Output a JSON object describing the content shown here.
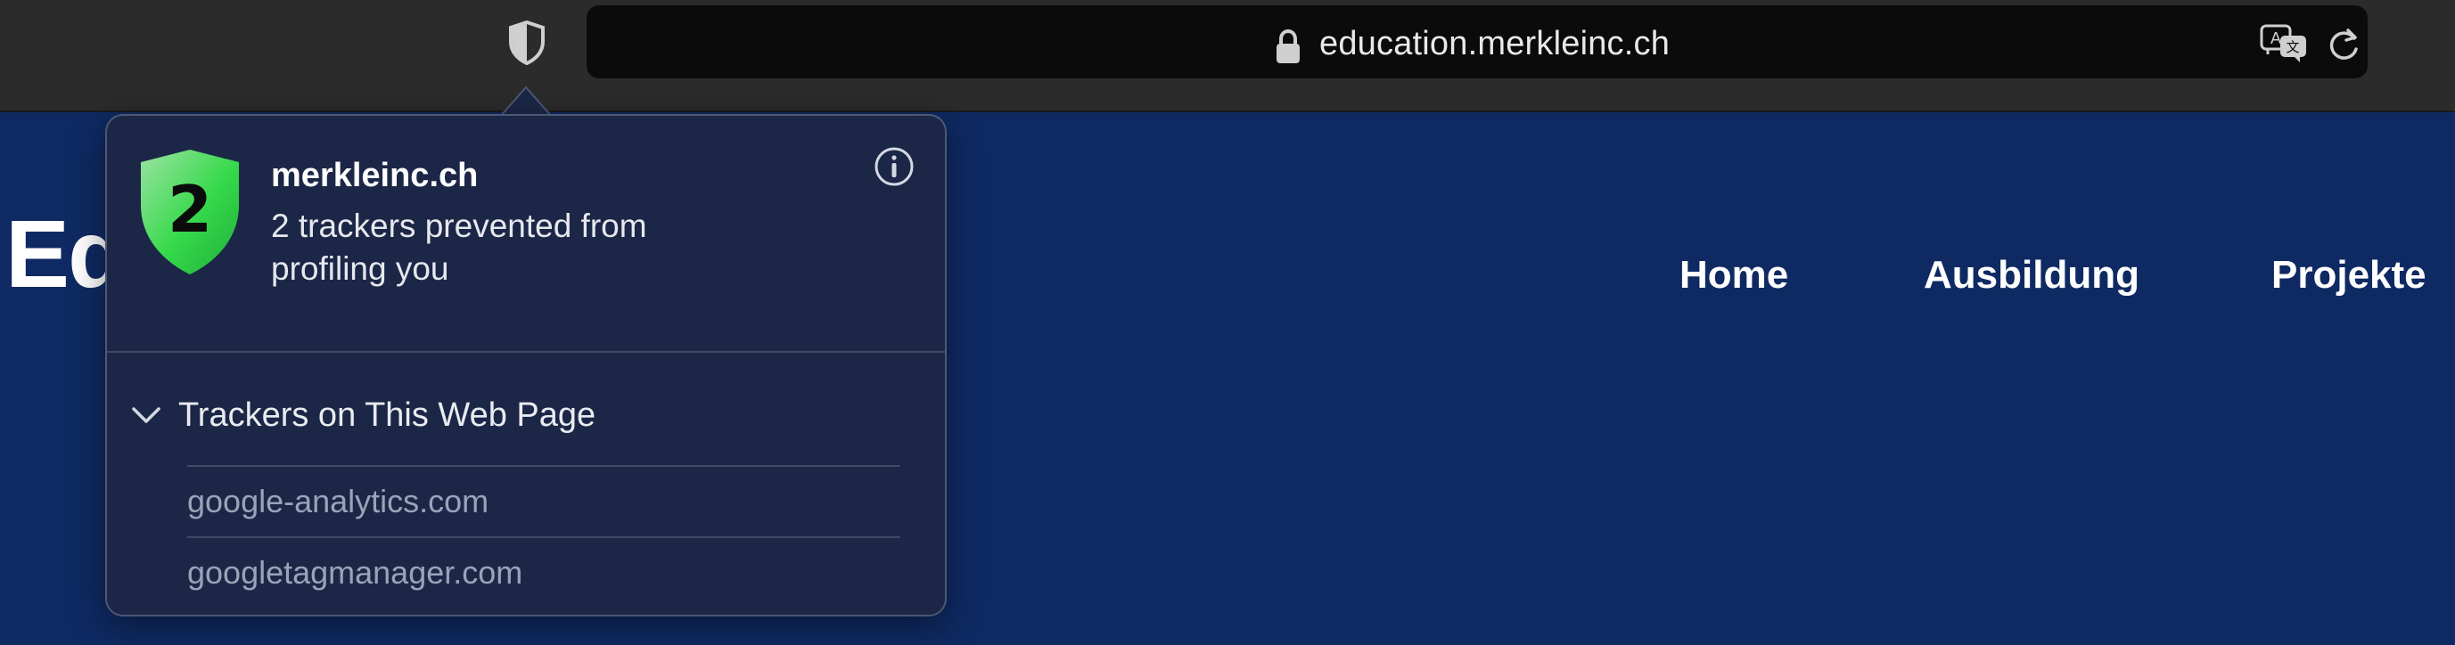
{
  "browser": {
    "url": "education.merkleinc.ch"
  },
  "page": {
    "logo_text": "Ed",
    "nav": [
      "Home",
      "Ausbildung",
      "Projekte"
    ]
  },
  "popover": {
    "badge_count": "2",
    "site": "merkleinc.ch",
    "summary": "2 trackers prevented from profiling you",
    "section_title": "Trackers on This Web Page",
    "trackers": [
      "google-analytics.com",
      "googletagmanager.com"
    ]
  },
  "colors": {
    "page_background": "#0f2a63",
    "popover_background": "#1c2747",
    "badge_green": "#35d94a"
  }
}
